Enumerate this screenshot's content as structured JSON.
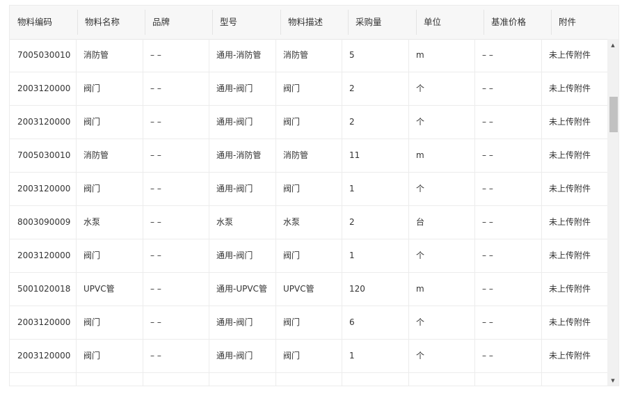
{
  "table": {
    "headers": [
      "物料编码",
      "物料名称",
      "品牌",
      "型号",
      "物料描述",
      "采购量",
      "单位",
      "基准价格",
      "附件"
    ],
    "rows": [
      [
        "7005030010",
        "消防管",
        "– –",
        "通用-消防管",
        "消防管",
        "5",
        "m",
        "– –",
        "未上传附件"
      ],
      [
        "2003120000",
        "阀门",
        "– –",
        "通用-阀门",
        "阀门",
        "2",
        "个",
        "– –",
        "未上传附件"
      ],
      [
        "2003120000",
        "阀门",
        "– –",
        "通用-阀门",
        "阀门",
        "2",
        "个",
        "– –",
        "未上传附件"
      ],
      [
        "7005030010",
        "消防管",
        "– –",
        "通用-消防管",
        "消防管",
        "11",
        "m",
        "– –",
        "未上传附件"
      ],
      [
        "2003120000",
        "阀门",
        "– –",
        "通用-阀门",
        "阀门",
        "1",
        "个",
        "– –",
        "未上传附件"
      ],
      [
        "8003090009",
        "水泵",
        "– –",
        "水泵",
        "水泵",
        "2",
        "台",
        "– –",
        "未上传附件"
      ],
      [
        "2003120000",
        "阀门",
        "– –",
        "通用-阀门",
        "阀门",
        "1",
        "个",
        "– –",
        "未上传附件"
      ],
      [
        "5001020018",
        "UPVC管",
        "– –",
        "通用-UPVC管",
        "UPVC管",
        "120",
        "m",
        "– –",
        "未上传附件"
      ],
      [
        "2003120000",
        "阀门",
        "– –",
        "通用-阀门",
        "阀门",
        "6",
        "个",
        "– –",
        "未上传附件"
      ],
      [
        "2003120000",
        "阀门",
        "– –",
        "通用-阀门",
        "阀门",
        "1",
        "个",
        "– –",
        "未上传附件"
      ]
    ]
  },
  "scrollbar": {
    "up_icon": "triangle-up-icon",
    "down_icon": "triangle-down-icon",
    "position_fraction": 0.14,
    "visible_fraction": 0.11
  }
}
